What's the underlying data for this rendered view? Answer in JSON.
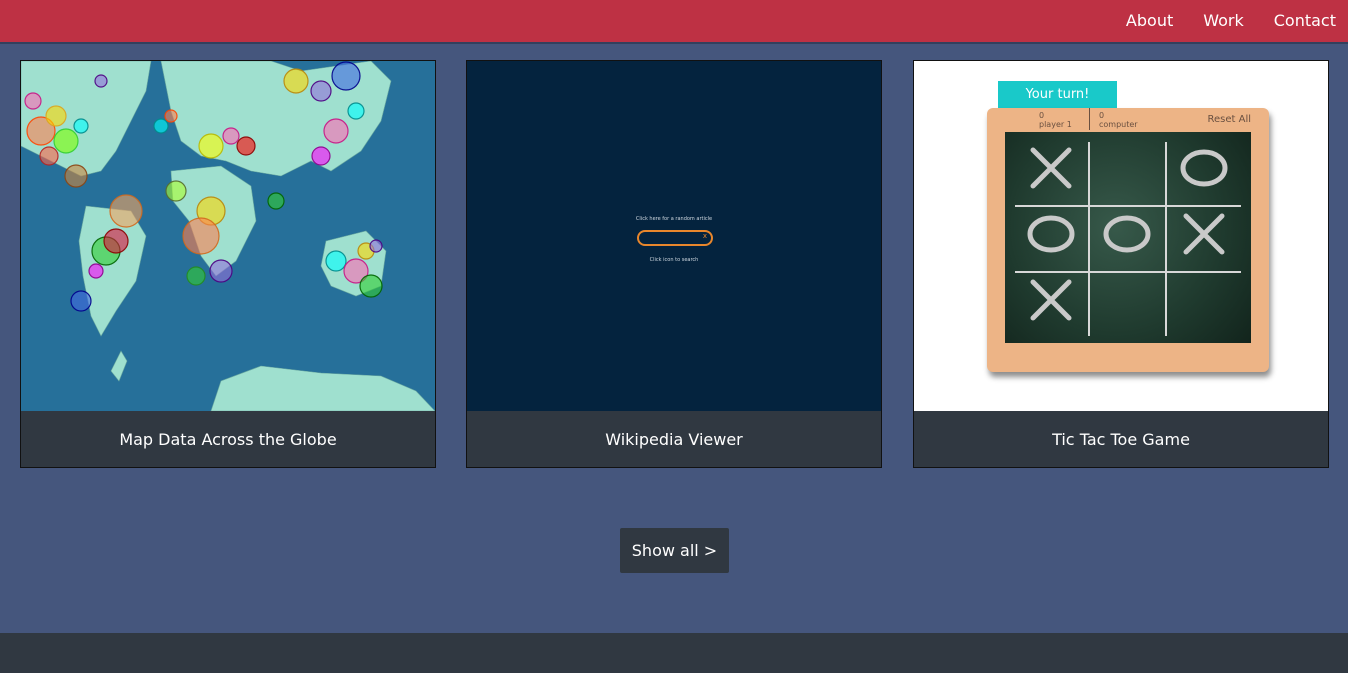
{
  "nav": {
    "links": [
      "About",
      "Work",
      "Contact"
    ]
  },
  "projects": [
    {
      "title": "Map Data Across the Globe"
    },
    {
      "title": "Wikipedia Viewer",
      "thumb": {
        "prompt": "Click here for a random article",
        "hint": "Click icon to search",
        "clear": "x"
      }
    },
    {
      "title": "Tic Tac Toe Game",
      "thumb": {
        "turn_label": "Your turn!",
        "player_score": "0",
        "player_label": "player 1",
        "computer_score": "0",
        "computer_label": "computer",
        "reset_label": "Reset All",
        "cells": [
          "X",
          "",
          "O",
          "O",
          "O",
          "X",
          "X",
          "",
          ""
        ]
      }
    }
  ],
  "show_all": "Show all >",
  "colors": {
    "nav_bg": "#be3144",
    "page_bg": "#45567d",
    "card_caption_bg": "#303841",
    "footer_bg": "#303841",
    "turn_badge": "#19c9c9"
  }
}
